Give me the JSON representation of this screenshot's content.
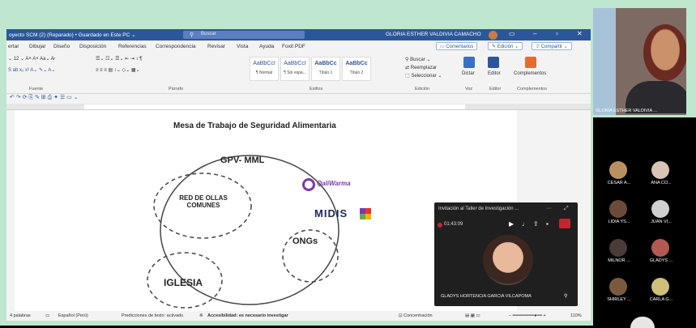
{
  "window": {
    "title": "oyecto SCM  (2) (Reparado) • Guardado en Este PC ⌄",
    "search_placeholder": "Buscar",
    "user": "GLORIA ESTHER VALDIVIA CAMACHO"
  },
  "menu": {
    "items": [
      "ertar",
      "Dibujar",
      "Diseño",
      "Disposición",
      "Referencias",
      "Correspondencia",
      "Revisar",
      "Vista",
      "Ayuda",
      "Foxit PDF"
    ],
    "comments": "Comentarios",
    "editing": "Edición",
    "share": "Compartir"
  },
  "ribbon": {
    "font_size": "12",
    "styles": [
      {
        "preview": "AaBbCcI",
        "name": "¶ Normal"
      },
      {
        "preview": "AaBbCcI",
        "name": "¶ Sin espa..."
      },
      {
        "preview": "AaBbCc",
        "name": "Título 1"
      },
      {
        "preview": "AaBbCc",
        "name": "Título 2"
      }
    ],
    "groups": [
      "Fuente",
      "Párrafo",
      "Estilos",
      "Edición",
      "Voz",
      "Editor",
      "Complementos"
    ],
    "editing_buttons": [
      "Buscar",
      "Reemplazar",
      "Seleccionar"
    ],
    "dictate": "Dictar",
    "editor": "Editor",
    "addins": "Complementos"
  },
  "document": {
    "title": "Mesa de Trabajo de Seguridad Alimentaria",
    "nodes": {
      "gpv": "GPV- MML",
      "red": "RED DE OLLAS COMUNES",
      "qali": "QaliWarma",
      "midis": "MIDIS",
      "ongs": "ONGs",
      "iglesia": "IGLESIA"
    }
  },
  "statusbar": {
    "words": "4 palabras",
    "language": "Español (Perú)",
    "predictions": "Predicciones de texto: activado",
    "accessibility": "Accesibilidad: es necesario investigar",
    "focus": "Concentración",
    "zoom": "110%"
  },
  "call_window": {
    "title": "Invitación al Taller de Investigación ...",
    "timer": "01:43:09",
    "participant": "GLADYS HORTENCIA GARCIA VILCAPOMA"
  },
  "main_video": {
    "name": "GLORIA ESTHER VALDIVIA ..."
  },
  "gallery": [
    {
      "name": "CESAR A..."
    },
    {
      "name": "ANA CO..."
    },
    {
      "name": "LIDIA YS..."
    },
    {
      "name": "JUAN VI..."
    },
    {
      "name": "MILNOR ..."
    },
    {
      "name": "GLADYS ..."
    },
    {
      "name": "SHIRLEY ..."
    },
    {
      "name": "CARLA G..."
    }
  ],
  "colors": {
    "word_blue": "#2b579a",
    "frame_bg": "#bfe6cf",
    "end_call": "#c4262e"
  }
}
